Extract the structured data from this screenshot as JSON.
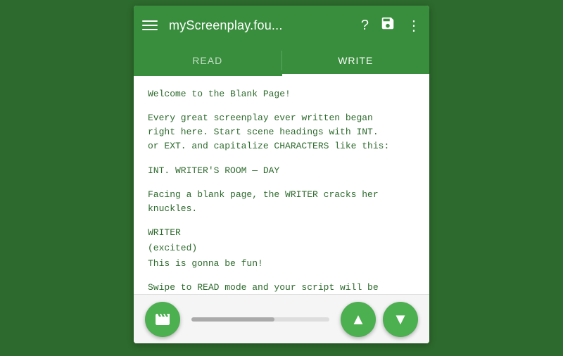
{
  "toolbar": {
    "menu_label": "menu",
    "title": "myScreenplay.fou...",
    "help_icon": "?",
    "save_icon": "💾",
    "more_icon": "⋮"
  },
  "tabs": [
    {
      "id": "read",
      "label": "READ",
      "active": false
    },
    {
      "id": "write",
      "label": "WRITE",
      "active": true
    }
  ],
  "screenplay": {
    "lines": [
      {
        "type": "prose",
        "text": "Welcome to the Blank Page!"
      },
      {
        "type": "prose",
        "text": "Every great screenplay ever written began\nright here. Start scene headings with INT.\nor EXT. and capitalize CHARACTERS like this:"
      },
      {
        "type": "scene-heading",
        "text": "INT. WRITER'S ROOM — DAY"
      },
      {
        "type": "prose",
        "text": "Facing a blank page, the WRITER cracks her\nknuckles."
      },
      {
        "type": "character-name",
        "text": "WRITER"
      },
      {
        "type": "parenthetical",
        "text": "(excited)"
      },
      {
        "type": "dialogue",
        "text": "This is gonna be fun!"
      },
      {
        "type": "prose",
        "text": "Swipe to READ mode and your script will be\nindented properly. Great! You're now a\nscreenplay-formatting expert! For more\nwriting tips, check the side drawer."
      }
    ]
  },
  "bottom": {
    "film_icon_label": "film-icon",
    "scroll_up_label": "▲",
    "scroll_down_label": "▼"
  }
}
